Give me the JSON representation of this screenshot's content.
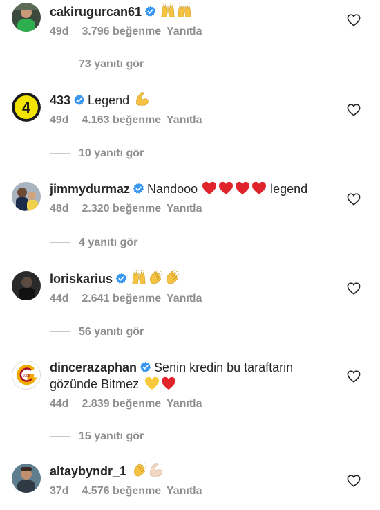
{
  "comments": [
    {
      "username": "cakirugurcan61",
      "text": "",
      "emojis": [
        "raising-hands",
        "raising-hands"
      ],
      "age": "49d",
      "likes": "3.796 beğenme",
      "reply": "Yanıtla",
      "view_replies": "73 yanıtı gör"
    },
    {
      "username": "433",
      "text": "Legend",
      "emojis": [
        "flexed-biceps"
      ],
      "age": "49d",
      "likes": "4.163 beğenme",
      "reply": "Yanıtla",
      "view_replies": "10 yanıtı gör"
    },
    {
      "username": "jimmydurmaz",
      "text": "Nandooo",
      "emojis": [
        "red-heart",
        "red-heart",
        "red-heart",
        "red-heart"
      ],
      "text_after": "legend",
      "age": "48d",
      "likes": "2.320 beğenme",
      "reply": "Yanıtla",
      "view_replies": "4 yanıtı gör"
    },
    {
      "username": "loriskarius",
      "text": "",
      "emojis": [
        "raising-hands",
        "clapping-hands",
        "clapping-hands"
      ],
      "age": "44d",
      "likes": "2.641 beğenme",
      "reply": "Yanıtla",
      "view_replies": "56 yanıtı gör"
    },
    {
      "username": "dincerazaphan",
      "text": "Senin kredin bu taraftarin",
      "text_line2": "gözünde Bitmez",
      "emojis": [
        "yellow-heart",
        "red-heart"
      ],
      "age": "44d",
      "likes": "2.839 beğenme",
      "reply": "Yanıtla",
      "view_replies": "15 yanıtı gör"
    },
    {
      "username": "altaybyndr_1",
      "text": "",
      "emojis": [
        "clapping-hands",
        "flexed-biceps"
      ],
      "age": "37d",
      "likes": "4.576 beğenme",
      "reply": "Yanıtla"
    }
  ],
  "colors": {
    "verified": "#3897f0",
    "muted": "#8e8e8e",
    "text": "#262626",
    "heart_red": "#e0242c",
    "heart_yellow": "#f6c83a",
    "emoji_yellow": "#f5c242"
  }
}
